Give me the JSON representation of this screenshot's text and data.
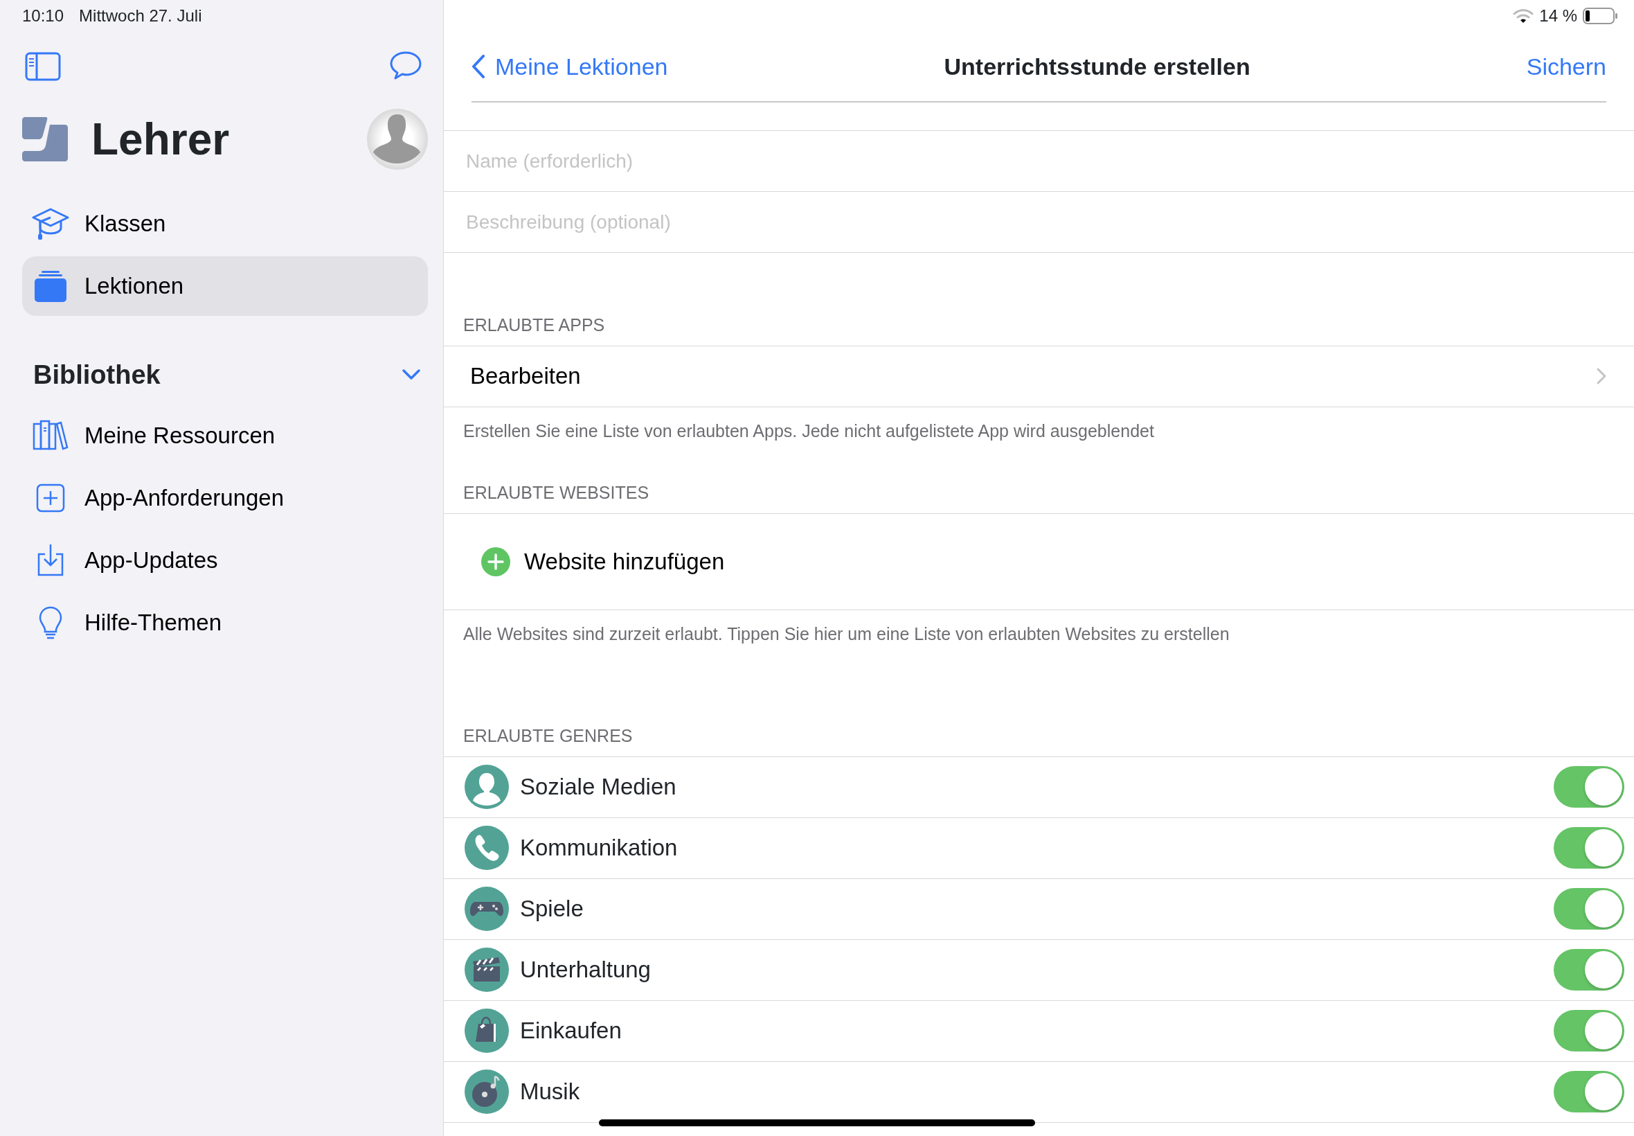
{
  "status_bar": {
    "time": "10:10",
    "date": "Mittwoch 27. Juli",
    "battery": "14 %"
  },
  "sidebar": {
    "title": "Lehrer",
    "items": [
      {
        "label": "Klassen",
        "selected": false
      },
      {
        "label": "Lektionen",
        "selected": true
      }
    ],
    "library": {
      "title": "Bibliothek",
      "expanded": true,
      "items": [
        {
          "label": "Meine Ressourcen"
        },
        {
          "label": "App-Anforderungen"
        },
        {
          "label": "App-Updates"
        },
        {
          "label": "Hilfe-Themen"
        }
      ]
    }
  },
  "navigation": {
    "back": "Meine Lektionen",
    "title": "Unterrichtsstunde erstellen",
    "action": "Sichern"
  },
  "fields": [
    {
      "placeholder": "Name (erforderlich)"
    },
    {
      "placeholder": "Beschreibung (optional)"
    }
  ],
  "allowed_apps": {
    "header": "ERLAUBTE APPS",
    "row": "Bearbeiten",
    "footer": "Erstellen Sie eine Liste von erlaubten Apps. Jede nicht aufgelistete App wird ausgeblendet"
  },
  "allowed_websites": {
    "header": "ERLAUBTE WEBSITES",
    "row": "Website hinzufügen",
    "footer": "Alle Websites sind zurzeit erlaubt. Tippen Sie hier um eine Liste von erlaubten Websites zu erstellen"
  },
  "allowed_genres": {
    "header": "ERLAUBTE GENRES",
    "items": [
      {
        "label": "Soziale Medien",
        "on": true
      },
      {
        "label": "Kommunikation",
        "on": true
      },
      {
        "label": "Spiele",
        "on": true
      },
      {
        "label": "Unterhaltung",
        "on": true
      },
      {
        "label": "Einkaufen",
        "on": true
      },
      {
        "label": "Musik",
        "on": true
      }
    ]
  }
}
